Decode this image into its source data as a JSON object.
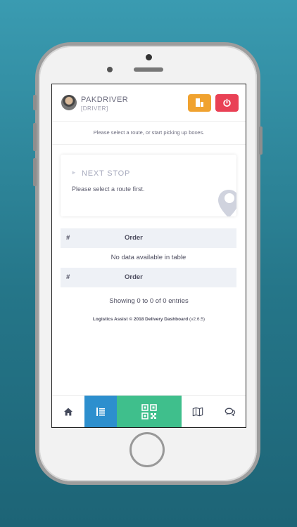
{
  "header": {
    "user_name": "PAKDRIVER",
    "user_role": "[DRIVER]",
    "boxes_button_icon": "boxes-icon",
    "logout_button_icon": "power-icon"
  },
  "notice": "Please select a route, or start picking up boxes.",
  "next_stop_card": {
    "title": "NEXT STOP",
    "message": "Please select a route first.",
    "icon": "location-pin-icon"
  },
  "table": {
    "columns": [
      "#",
      "Order"
    ],
    "empty_message": "No data available in table"
  },
  "entries_info": "Showing 0 to 0 of 0 entries",
  "footer": {
    "text": "Logistics Assist © 2018 Delivery Dashboard",
    "version": "(v2.6.5)"
  },
  "bottom_nav": [
    {
      "icon": "home-icon",
      "active": false
    },
    {
      "icon": "list-icon",
      "active": true
    },
    {
      "icon": "qr-code-icon",
      "active": false
    },
    {
      "icon": "map-icon",
      "active": false
    },
    {
      "icon": "chat-icon",
      "active": false
    }
  ],
  "colors": {
    "orange": "#f0a22f",
    "red": "#e94155",
    "blue": "#2d8fce",
    "green": "#3fbf8c"
  }
}
